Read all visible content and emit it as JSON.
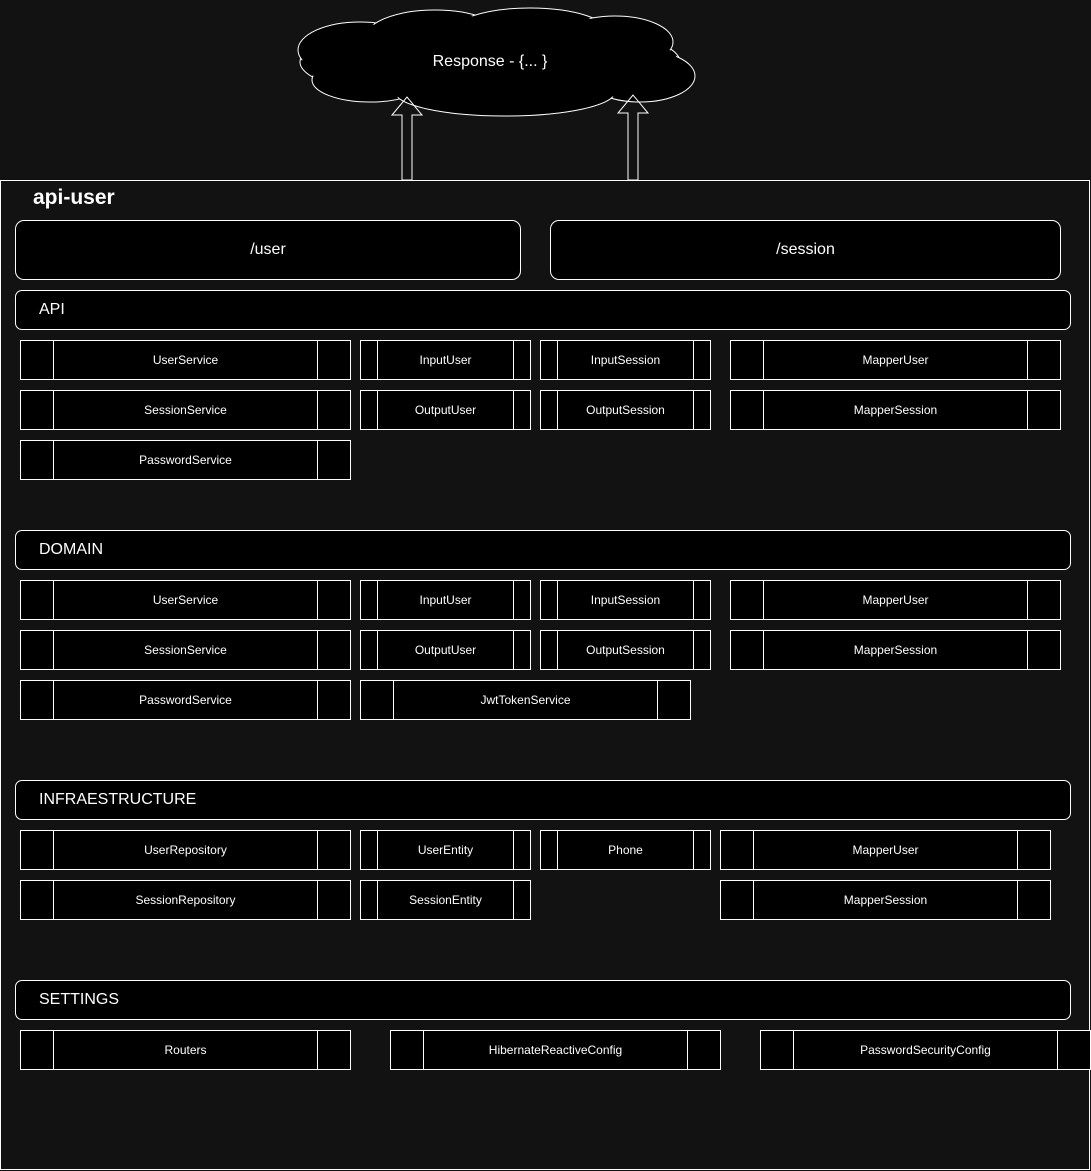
{
  "response_cloud": {
    "label": "Response - {... }"
  },
  "app": {
    "title": "api-user"
  },
  "endpoints": {
    "user": "/user",
    "session": "/session"
  },
  "layers": {
    "api": {
      "label": "API",
      "items": [
        "UserService",
        "InputUser",
        "InputSession",
        "MapperUser",
        "SessionService",
        "OutputUser",
        "OutputSession",
        "MapperSession",
        "PasswordService"
      ]
    },
    "domain": {
      "label": "DOMAIN",
      "items": [
        "UserService",
        "InputUser",
        "InputSession",
        "MapperUser",
        "SessionService",
        "OutputUser",
        "OutputSession",
        "MapperSession",
        "PasswordService",
        "JwtTokenService"
      ]
    },
    "infra": {
      "label": "INFRAESTRUCTURE",
      "items": [
        "UserRepository",
        "UserEntity",
        "Phone",
        "MapperUser",
        "SessionRepository",
        "SessionEntity",
        "MapperSession"
      ]
    },
    "settings": {
      "label": "SETTINGS",
      "items": [
        "Routers",
        "HibernateReactiveConfig",
        "PasswordSecurityConfig"
      ]
    }
  },
  "colors": {
    "background": "#121212",
    "box_fill": "#000000",
    "stroke": "#ffffff"
  }
}
